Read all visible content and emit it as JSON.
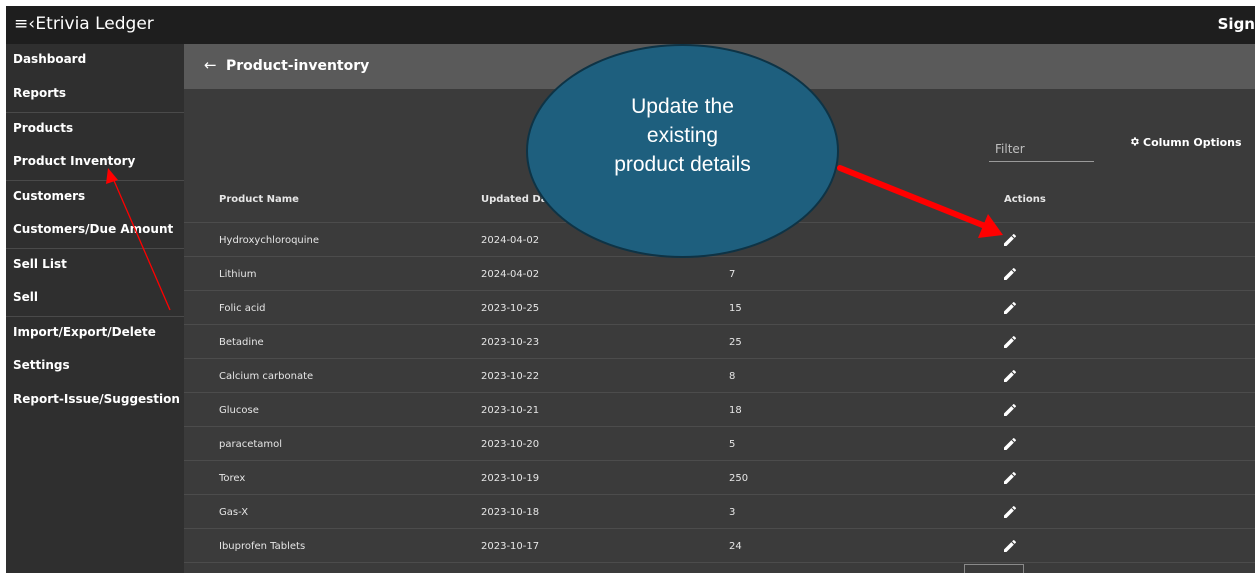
{
  "app": {
    "title": "Etrivia Ledger",
    "menu_icon": "≡‹",
    "signin_label": "Sign"
  },
  "sidebar": {
    "items": [
      {
        "label": "Dashboard"
      },
      {
        "label": "Reports"
      },
      {
        "label": "Products"
      },
      {
        "label": "Product Inventory"
      },
      {
        "label": "Customers"
      },
      {
        "label": "Customers/Due Amount"
      },
      {
        "label": "Sell List"
      },
      {
        "label": "Sell"
      },
      {
        "label": "Import/Export/Delete"
      },
      {
        "label": "Settings"
      },
      {
        "label": "Report-Issue/Suggestion"
      }
    ]
  },
  "header": {
    "back_icon": "←",
    "title": "Product-inventory"
  },
  "toolbar": {
    "filter_placeholder": "Filter",
    "column_options_label": "Column Options"
  },
  "table": {
    "columns": [
      "Product Name",
      "Updated Date",
      "Actions"
    ],
    "rows": [
      {
        "name": "Hydroxychloroquine",
        "date": "2024-04-02",
        "qty": ""
      },
      {
        "name": "Lithium",
        "date": "2024-04-02",
        "qty": "7"
      },
      {
        "name": "Folic acid",
        "date": "2023-10-25",
        "qty": "15"
      },
      {
        "name": "Betadine",
        "date": "2023-10-23",
        "qty": "25"
      },
      {
        "name": "Calcium carbonate",
        "date": "2023-10-22",
        "qty": "8"
      },
      {
        "name": "Glucose",
        "date": "2023-10-21",
        "qty": "18"
      },
      {
        "name": "paracetamol",
        "date": "2023-10-20",
        "qty": "5"
      },
      {
        "name": "Torex",
        "date": "2023-10-19",
        "qty": "250"
      },
      {
        "name": "Gas-X",
        "date": "2023-10-18",
        "qty": "3"
      },
      {
        "name": "Ibuprofen Tablets",
        "date": "2023-10-17",
        "qty": "24"
      }
    ]
  },
  "annotation": {
    "callout_lines": [
      "Update the",
      "existing",
      "product details"
    ],
    "colors": {
      "callout_fill": "#1e5f7e",
      "arrow": "#ff0000"
    }
  }
}
